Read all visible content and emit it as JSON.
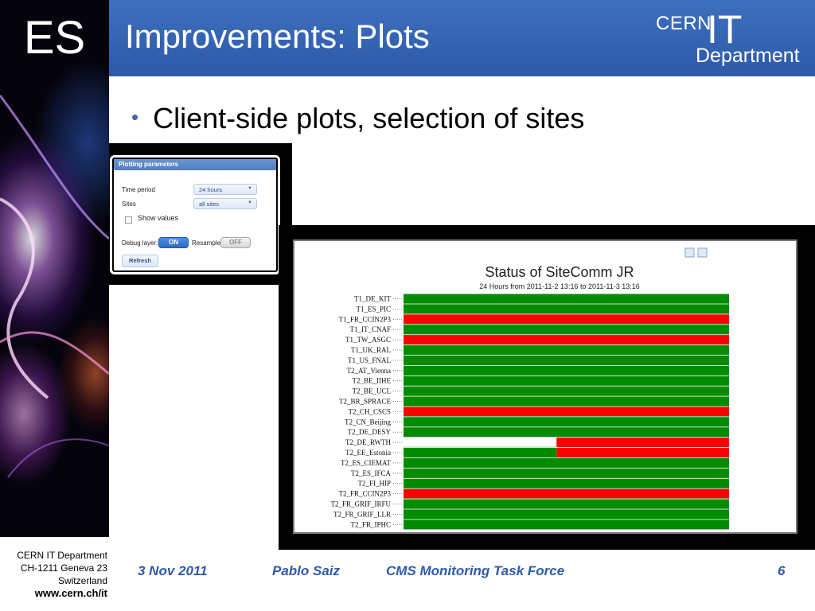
{
  "slide": {
    "logo": "ES",
    "title": "Improvements: Plots",
    "cern_logo": {
      "cern": "CERN",
      "it": "IT",
      "department": "Department"
    },
    "bullet": "Client-side plots, selection of sites"
  },
  "plotting_params": {
    "title": "Plotting parameters",
    "time_period_label": "Time period",
    "time_period_value": "24 hours",
    "sites_label": "Sites",
    "sites_value": "all sites",
    "show_values_label": "Show values",
    "debug_layer_label": "Debug layer:",
    "debug_layer_value": "ON",
    "resample_label": "Resample:",
    "resample_value": "OFF",
    "refresh_label": "Refresh"
  },
  "chart_data": {
    "type": "heatmap",
    "title": "Status of SiteComm JR",
    "subtitle": "24 Hours from 2011-11-2 13:16 to 2011-11-3 13:16",
    "colors": {
      "ok": "#008c00",
      "error": "#ff0000",
      "none": "#ffffff"
    },
    "rows": [
      {
        "site": "T1_DE_KIT",
        "segments": [
          {
            "from": 0,
            "to": 1,
            "status": "ok"
          }
        ]
      },
      {
        "site": "T1_ES_PIC",
        "segments": [
          {
            "from": 0,
            "to": 1,
            "status": "ok"
          }
        ]
      },
      {
        "site": "T1_FR_CCIN2P3",
        "segments": [
          {
            "from": 0,
            "to": 1,
            "status": "error"
          }
        ]
      },
      {
        "site": "T1_IT_CNAF",
        "segments": [
          {
            "from": 0,
            "to": 1,
            "status": "ok"
          }
        ]
      },
      {
        "site": "T1_TW_ASGC",
        "segments": [
          {
            "from": 0,
            "to": 1,
            "status": "error"
          }
        ]
      },
      {
        "site": "T1_UK_RAL",
        "segments": [
          {
            "from": 0,
            "to": 1,
            "status": "ok"
          }
        ]
      },
      {
        "site": "T1_US_FNAL",
        "segments": [
          {
            "from": 0,
            "to": 1,
            "status": "ok"
          }
        ]
      },
      {
        "site": "T2_AT_Vienna",
        "segments": [
          {
            "from": 0,
            "to": 1,
            "status": "ok"
          }
        ]
      },
      {
        "site": "T2_BE_IIHE",
        "segments": [
          {
            "from": 0,
            "to": 1,
            "status": "ok"
          }
        ]
      },
      {
        "site": "T2_BE_UCL",
        "segments": [
          {
            "from": 0,
            "to": 1,
            "status": "ok"
          }
        ]
      },
      {
        "site": "T2_BR_SPRACE",
        "segments": [
          {
            "from": 0,
            "to": 1,
            "status": "ok"
          }
        ]
      },
      {
        "site": "T2_CH_CSCS",
        "segments": [
          {
            "from": 0,
            "to": 1,
            "status": "error"
          }
        ]
      },
      {
        "site": "T2_CN_Beijing",
        "segments": [
          {
            "from": 0,
            "to": 1,
            "status": "ok"
          }
        ]
      },
      {
        "site": "T2_DE_DESY",
        "segments": [
          {
            "from": 0,
            "to": 1,
            "status": "ok"
          }
        ]
      },
      {
        "site": "T2_DE_RWTH",
        "segments": [
          {
            "from": 0,
            "to": 0.47,
            "status": "none"
          },
          {
            "from": 0.47,
            "to": 1,
            "status": "error"
          }
        ]
      },
      {
        "site": "T2_EE_Estonia",
        "segments": [
          {
            "from": 0,
            "to": 0.47,
            "status": "ok"
          },
          {
            "from": 0.47,
            "to": 1,
            "status": "error"
          }
        ]
      },
      {
        "site": "T2_ES_CIEMAT",
        "segments": [
          {
            "from": 0,
            "to": 1,
            "status": "ok"
          }
        ]
      },
      {
        "site": "T2_ES_IFCA",
        "segments": [
          {
            "from": 0,
            "to": 1,
            "status": "ok"
          }
        ]
      },
      {
        "site": "T2_FI_HIP",
        "segments": [
          {
            "from": 0,
            "to": 1,
            "status": "ok"
          }
        ]
      },
      {
        "site": "T2_FR_CCIN2P3",
        "segments": [
          {
            "from": 0,
            "to": 1,
            "status": "error"
          }
        ]
      },
      {
        "site": "T2_FR_GRIF_IRFU",
        "segments": [
          {
            "from": 0,
            "to": 1,
            "status": "ok"
          }
        ]
      },
      {
        "site": "T2_FR_GRIF_LLR",
        "segments": [
          {
            "from": 0,
            "to": 1,
            "status": "ok"
          }
        ]
      },
      {
        "site": "T2_FR_IPHC",
        "segments": [
          {
            "from": 0,
            "to": 1,
            "status": "ok"
          }
        ]
      }
    ]
  },
  "footer": {
    "address_line1": "CERN IT Department",
    "address_line2": "CH-1211 Geneva 23",
    "address_line3": "Switzerland",
    "website": "www.cern.ch/it",
    "date": "3 Nov 2011",
    "author": "Pablo Saiz",
    "event": "CMS Monitoring Task Force",
    "page": "6"
  }
}
